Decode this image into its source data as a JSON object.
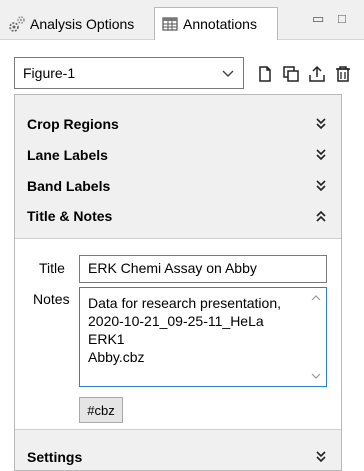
{
  "tabs": [
    {
      "label": "Analysis Options",
      "icon": "analysis-gears-icon",
      "active": false
    },
    {
      "label": "Annotations",
      "icon": "annotations-table-icon",
      "active": true
    }
  ],
  "window_controls": {
    "minimize_glyph": "▭",
    "maximize_glyph": "□"
  },
  "toolbar": {
    "figure_select": {
      "value": "Figure-1"
    },
    "buttons": [
      {
        "icon": "new-document-icon"
      },
      {
        "icon": "duplicate-icon"
      },
      {
        "icon": "export-icon"
      },
      {
        "icon": "delete-icon"
      }
    ]
  },
  "sections": [
    {
      "label": "Crop Regions",
      "state": "collapsed"
    },
    {
      "label": "Lane Labels",
      "state": "collapsed"
    },
    {
      "label": "Band Labels",
      "state": "collapsed"
    },
    {
      "label": "Title & Notes",
      "state": "expanded"
    },
    {
      "label": "Settings",
      "state": "collapsed"
    }
  ],
  "title_notes": {
    "title_label": "Title",
    "title_value": "ERK Chemi Assay on Abby",
    "notes_label": "Notes",
    "notes_value": "Data for research presentation,\n2020-10-21_09-25-11_HeLa ERK1\nAbby.cbz",
    "tags": [
      "#cbz"
    ]
  },
  "colors": {
    "focus_border": "#2f7fd6",
    "panel_bg": "#f0f0f0"
  }
}
